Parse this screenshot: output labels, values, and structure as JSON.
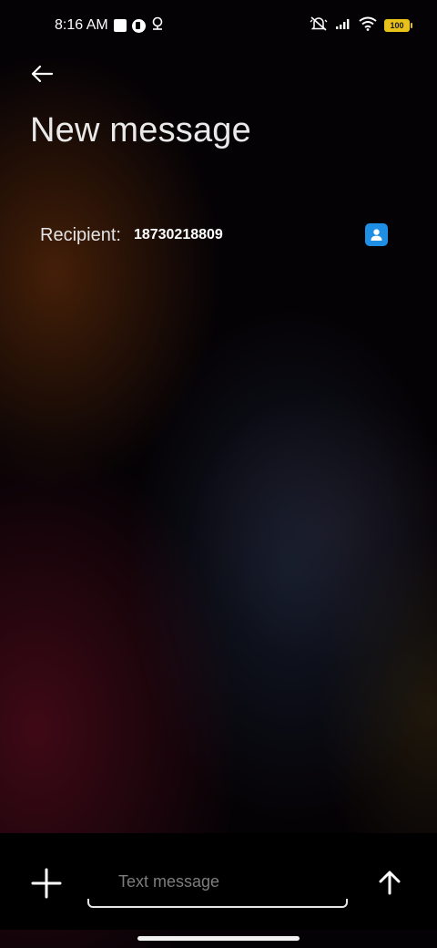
{
  "status_bar": {
    "time": "8:16 AM",
    "battery_level": "100",
    "icons": [
      "square-notification-icon",
      "app-notification-icon",
      "location-icon",
      "mute-icon",
      "signal-icon",
      "wifi-icon",
      "battery-icon"
    ]
  },
  "header": {
    "back_icon": "arrow-left-icon",
    "title": "New message"
  },
  "recipient": {
    "label": "Recipient:",
    "value": "18730218809",
    "contact_icon": "contact-picker-icon"
  },
  "compose": {
    "attach_icon": "plus-icon",
    "placeholder": "Text message",
    "value": "",
    "send_icon": "arrow-up-icon"
  },
  "colors": {
    "accent_blue": "#1f8fe6",
    "battery_yellow": "#e8c21b",
    "placeholder_gray": "#7d7d7d"
  }
}
